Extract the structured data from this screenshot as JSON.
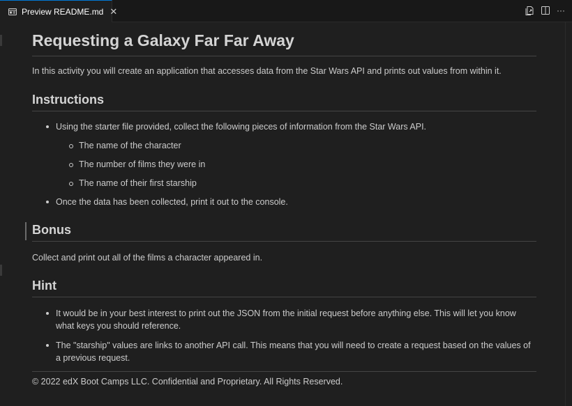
{
  "tab": {
    "label": "Preview README.md",
    "close_glyph": "✕",
    "icon": "preview-icon"
  },
  "actions": [
    {
      "name": "open-source-icon"
    },
    {
      "name": "split-editor-icon"
    },
    {
      "name": "more-actions-icon",
      "glyph": "···"
    }
  ],
  "doc": {
    "title": "Requesting a Galaxy Far Far Away",
    "intro": "In this activity you will create an application that accesses data from the Star Wars API and prints out values from within it.",
    "instructions_heading": "Instructions",
    "instructions": {
      "item1": "Using the starter file provided, collect the following pieces of information from the Star Wars API.",
      "sub1": "The name of the character",
      "sub2": "The number of films they were in",
      "sub3": "The name of their first starship",
      "item2": "Once the data has been collected, print it out to the console."
    },
    "bonus_heading": "Bonus",
    "bonus_text": "Collect and print out all of the films a character appeared in.",
    "hint_heading": "Hint",
    "hints": {
      "item1": "It would be in your best interest to print out the JSON from the initial request before anything else. This will let you know what keys you should reference.",
      "item2": "The \"starship\" values are links to another API call. This means that you will need to create a request based on the values of a previous request."
    },
    "footer": "© 2022 edX Boot Camps LLC. Confidential and Proprietary. All Rights Reserved."
  }
}
